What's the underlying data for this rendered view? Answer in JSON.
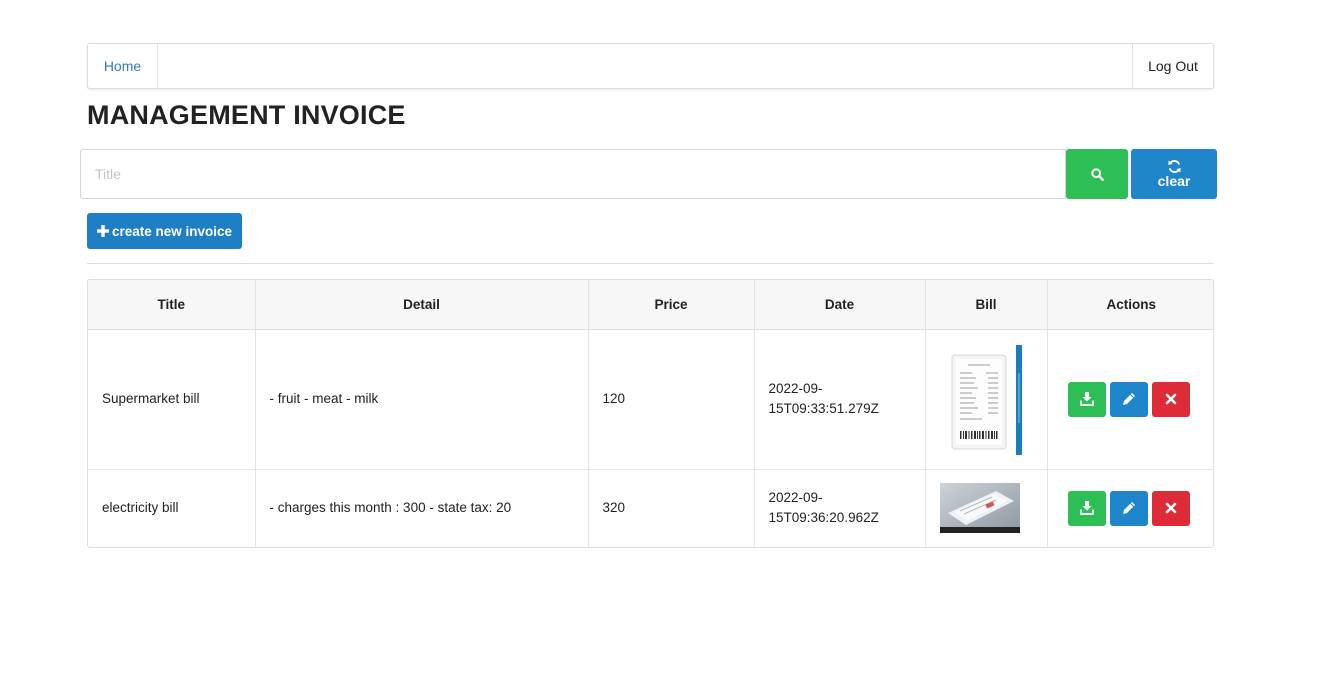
{
  "nav": {
    "home_label": "Home",
    "logout_label": "Log Out"
  },
  "page": {
    "title": "MANAGEMENT INVOICE"
  },
  "search": {
    "placeholder": "Title",
    "value": "",
    "search_icon": "search-icon",
    "clear_icon": "refresh-icon",
    "clear_label": "clear"
  },
  "create": {
    "icon": "plus-icon",
    "label": "create new invoice"
  },
  "table": {
    "headers": [
      "Title",
      "Detail",
      "Price",
      "Date",
      "Bill",
      "Actions"
    ],
    "rows": [
      {
        "title": "Supermarket bill",
        "detail": "- fruit - meat - milk",
        "price": "120",
        "date": "2022-09-15T09:33:51.279Z",
        "bill_image": "receipt-thumbnail"
      },
      {
        "title": "electricity bill",
        "detail": "- charges this month : 300 - state tax: 20",
        "price": "320",
        "date": "2022-09-15T09:36:20.962Z",
        "bill_image": "bill-photo-thumbnail"
      }
    ],
    "action_icons": [
      "download-icon",
      "pencil-icon",
      "close-icon"
    ]
  },
  "colors": {
    "link": "#337ab7",
    "success": "#2dbe55",
    "primary": "#1f86c9",
    "danger": "#dd2c38"
  }
}
